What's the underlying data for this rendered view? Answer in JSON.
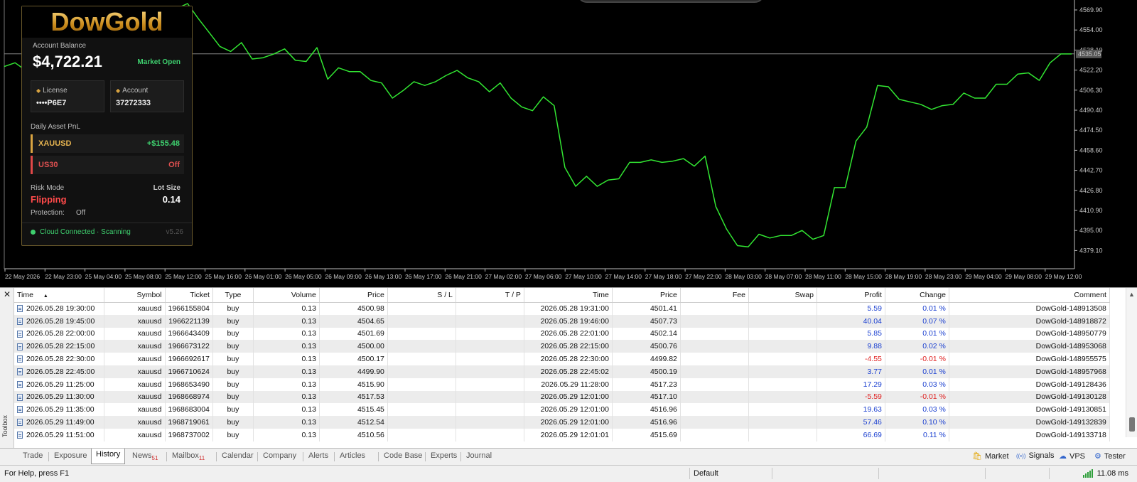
{
  "chart": {
    "line_color": "#32e632",
    "current_price_label": "4535.05",
    "price_labels": [
      "4569.90",
      "4554.00",
      "4538.10",
      "4522.20",
      "4506.30",
      "4490.40",
      "4474.50",
      "4458.60",
      "4442.70",
      "4426.80",
      "4410.90",
      "4395.00",
      "4379.10"
    ],
    "time_labels": [
      "22 May 2026",
      "22 May 23:00",
      "25 May 04:00",
      "25 May 08:00",
      "25 May 12:00",
      "25 May 16:00",
      "26 May 01:00",
      "26 May 05:00",
      "26 May 09:00",
      "26 May 13:00",
      "26 May 17:00",
      "26 May 21:00",
      "27 May 02:00",
      "27 May 06:00",
      "27 May 10:00",
      "27 May 14:00",
      "27 May 18:00",
      "27 May 22:00",
      "28 May 03:00",
      "28 May 07:00",
      "28 May 11:00",
      "28 May 15:00",
      "28 May 19:00",
      "28 May 23:00",
      "29 May 04:00",
      "29 May 08:00",
      "29 May 12:00"
    ],
    "series": [
      4525,
      4528,
      4522,
      4531,
      4540,
      4545,
      4552,
      4553,
      4558,
      4562,
      4568,
      4566,
      4571,
      4569,
      4566,
      4570,
      4571,
      4575,
      4563,
      4552,
      4541,
      4537,
      4544,
      4531,
      4532,
      4535,
      4539,
      4530,
      4529,
      4540,
      4515,
      4524,
      4521,
      4521,
      4514,
      4512,
      4500,
      4506,
      4513,
      4510,
      4513,
      4518,
      4522,
      4516,
      4513,
      4505,
      4512,
      4500,
      4493,
      4490,
      4501,
      4494,
      4445,
      4430,
      4438,
      4430,
      4435,
      4436,
      4449,
      4449,
      4451,
      4449,
      4450,
      4452,
      4446,
      4454,
      4414,
      4396,
      4383,
      4382,
      4392,
      4389,
      4391,
      4391,
      4395,
      4388,
      4391,
      4429,
      4429,
      4466,
      4477,
      4510,
      4509,
      4499,
      4497,
      4495,
      4491,
      4494,
      4495,
      4504,
      4500,
      4500,
      4511,
      4511,
      4519,
      4520,
      4514,
      4528,
      4535,
      4535
    ]
  },
  "panel": {
    "logo": "DowGold",
    "balance_label": "Account Balance",
    "balance": "$4,722.21",
    "market_status": "Market Open",
    "license_label": "License",
    "license_value": "••••P6E7",
    "account_label": "Account",
    "account_value": "37272333",
    "pnl_label": "Daily Asset PnL",
    "assets": [
      {
        "name": "XAUUSD",
        "value": "+$155.48"
      },
      {
        "name": "US30",
        "value": "Off"
      }
    ],
    "risk_label": "Risk Mode",
    "risk_value": "Flipping",
    "lot_label": "Lot Size",
    "lot_value": "0.14",
    "protection_label": "Protection:",
    "protection_value": "Off",
    "cloud_status": "Cloud Connected · Scanning",
    "version": "v5.26"
  },
  "toolbox": {
    "side_label": "Toolbox",
    "columns": [
      "Time",
      "Symbol",
      "Ticket",
      "Type",
      "Volume",
      "Price",
      "S / L",
      "T / P",
      "Time",
      "Price",
      "Fee",
      "Swap",
      "Profit",
      "Change",
      "Comment"
    ],
    "rows": [
      [
        "2026.05.28 19:30:00",
        "xauusd",
        "1966155804",
        "buy",
        "0.13",
        "4500.98",
        "",
        "",
        "2026.05.28 19:31:00",
        "4501.41",
        "",
        "",
        "5.59",
        "0.01 %",
        "DowGold-148913508"
      ],
      [
        "2026.05.28 19:45:00",
        "xauusd",
        "1966221139",
        "buy",
        "0.13",
        "4504.65",
        "",
        "",
        "2026.05.28 19:46:00",
        "4507.73",
        "",
        "",
        "40.04",
        "0.07 %",
        "DowGold-148918872"
      ],
      [
        "2026.05.28 22:00:00",
        "xauusd",
        "1966643409",
        "buy",
        "0.13",
        "4501.69",
        "",
        "",
        "2026.05.28 22:01:00",
        "4502.14",
        "",
        "",
        "5.85",
        "0.01 %",
        "DowGold-148950779"
      ],
      [
        "2026.05.28 22:15:00",
        "xauusd",
        "1966673122",
        "buy",
        "0.13",
        "4500.00",
        "",
        "",
        "2026.05.28 22:15:00",
        "4500.76",
        "",
        "",
        "9.88",
        "0.02 %",
        "DowGold-148953068"
      ],
      [
        "2026.05.28 22:30:00",
        "xauusd",
        "1966692617",
        "buy",
        "0.13",
        "4500.17",
        "",
        "",
        "2026.05.28 22:30:00",
        "4499.82",
        "",
        "",
        "-4.55",
        "-0.01 %",
        "DowGold-148955575"
      ],
      [
        "2026.05.28 22:45:00",
        "xauusd",
        "1966710624",
        "buy",
        "0.13",
        "4499.90",
        "",
        "",
        "2026.05.28 22:45:02",
        "4500.19",
        "",
        "",
        "3.77",
        "0.01 %",
        "DowGold-148957968"
      ],
      [
        "2026.05.29 11:25:00",
        "xauusd",
        "1968653490",
        "buy",
        "0.13",
        "4515.90",
        "",
        "",
        "2026.05.29 11:28:00",
        "4517.23",
        "",
        "",
        "17.29",
        "0.03 %",
        "DowGold-149128436"
      ],
      [
        "2026.05.29 11:30:00",
        "xauusd",
        "1968668974",
        "buy",
        "0.13",
        "4517.53",
        "",
        "",
        "2026.05.29 12:01:00",
        "4517.10",
        "",
        "",
        "-5.59",
        "-0.01 %",
        "DowGold-149130128"
      ],
      [
        "2026.05.29 11:35:00",
        "xauusd",
        "1968683004",
        "buy",
        "0.13",
        "4515.45",
        "",
        "",
        "2026.05.29 12:01:00",
        "4516.96",
        "",
        "",
        "19.63",
        "0.03 %",
        "DowGold-149130851"
      ],
      [
        "2026.05.29 11:49:00",
        "xauusd",
        "1968719061",
        "buy",
        "0.13",
        "4512.54",
        "",
        "",
        "2026.05.29 12:01:00",
        "4516.96",
        "",
        "",
        "57.46",
        "0.10 %",
        "DowGold-149132839"
      ],
      [
        "2026.05.29 11:51:00",
        "xauusd",
        "1968737002",
        "buy",
        "0.13",
        "4510.56",
        "",
        "",
        "2026.05.29 12:01:01",
        "4515.69",
        "",
        "",
        "66.69",
        "0.11 %",
        "DowGold-149133718"
      ]
    ]
  },
  "tabs": [
    {
      "label": "Trade"
    },
    {
      "label": "Exposure"
    },
    {
      "label": "History",
      "active": true
    },
    {
      "label": "News",
      "badge": "51"
    },
    {
      "label": "Mailbox",
      "badge": "11"
    },
    {
      "label": "Calendar"
    },
    {
      "label": "Company"
    },
    {
      "label": "Alerts"
    },
    {
      "label": "Articles"
    },
    {
      "label": "Code Base"
    },
    {
      "label": "Experts"
    },
    {
      "label": "Journal"
    }
  ],
  "right_tabs": [
    {
      "label": "Market",
      "icon": "bag-icon"
    },
    {
      "label": "Signals",
      "icon": "signals-icon"
    },
    {
      "label": "VPS",
      "icon": "cloud-icon"
    },
    {
      "label": "Tester",
      "icon": "tester-icon"
    }
  ],
  "status": {
    "help": "For Help, press F1",
    "profile": "Default",
    "ping": "11.08 ms"
  }
}
